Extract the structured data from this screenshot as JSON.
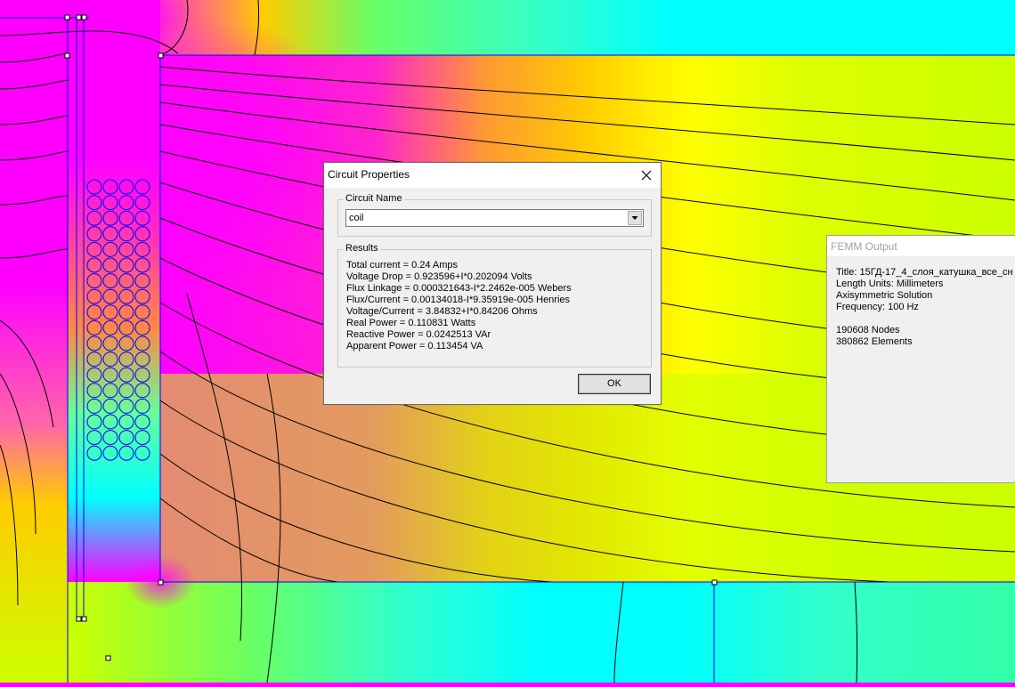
{
  "circuit_dialog": {
    "title": "Circuit Properties",
    "circuit_name_label": "Circuit Name",
    "circuit_name_value": "coil",
    "results_label": "Results",
    "results": [
      "Total current = 0.24 Amps",
      "Voltage Drop = 0.923596+I*0.202094 Volts",
      "Flux Linkage = 0.000321643-I*2.2462e-005 Webers",
      "Flux/Current = 0.00134018-I*9.35919e-005 Henries",
      "Voltage/Current = 3.84832+I*0.84206 Ohms",
      "Real Power = 0.110831 Watts",
      "Reactive Power = 0.0242513 VAr",
      "Apparent Power = 0.113454 VA"
    ],
    "ok_label": "OK"
  },
  "femm_output": {
    "title": "FEMM Output",
    "lines": [
      "Title: 15ГД-17_4_слоя_катушка_все_сн",
      "Length Units: Millimeters",
      "Axisymmetric Solution",
      "Frequency: 100 Hz",
      "",
      "190608 Nodes",
      "380862 Elements"
    ]
  },
  "colors": {
    "magenta": "#ff00ff",
    "yellow_green": "#ccff00",
    "yellow": "#ffff00",
    "cyan": "#00ffff",
    "aqua_green": "#33ffcc",
    "orange": "#ff9933",
    "contour": "#000000",
    "boundary": "#0000ff"
  },
  "icons": {
    "close": "close-icon",
    "dropdown": "chevron-down-icon"
  }
}
